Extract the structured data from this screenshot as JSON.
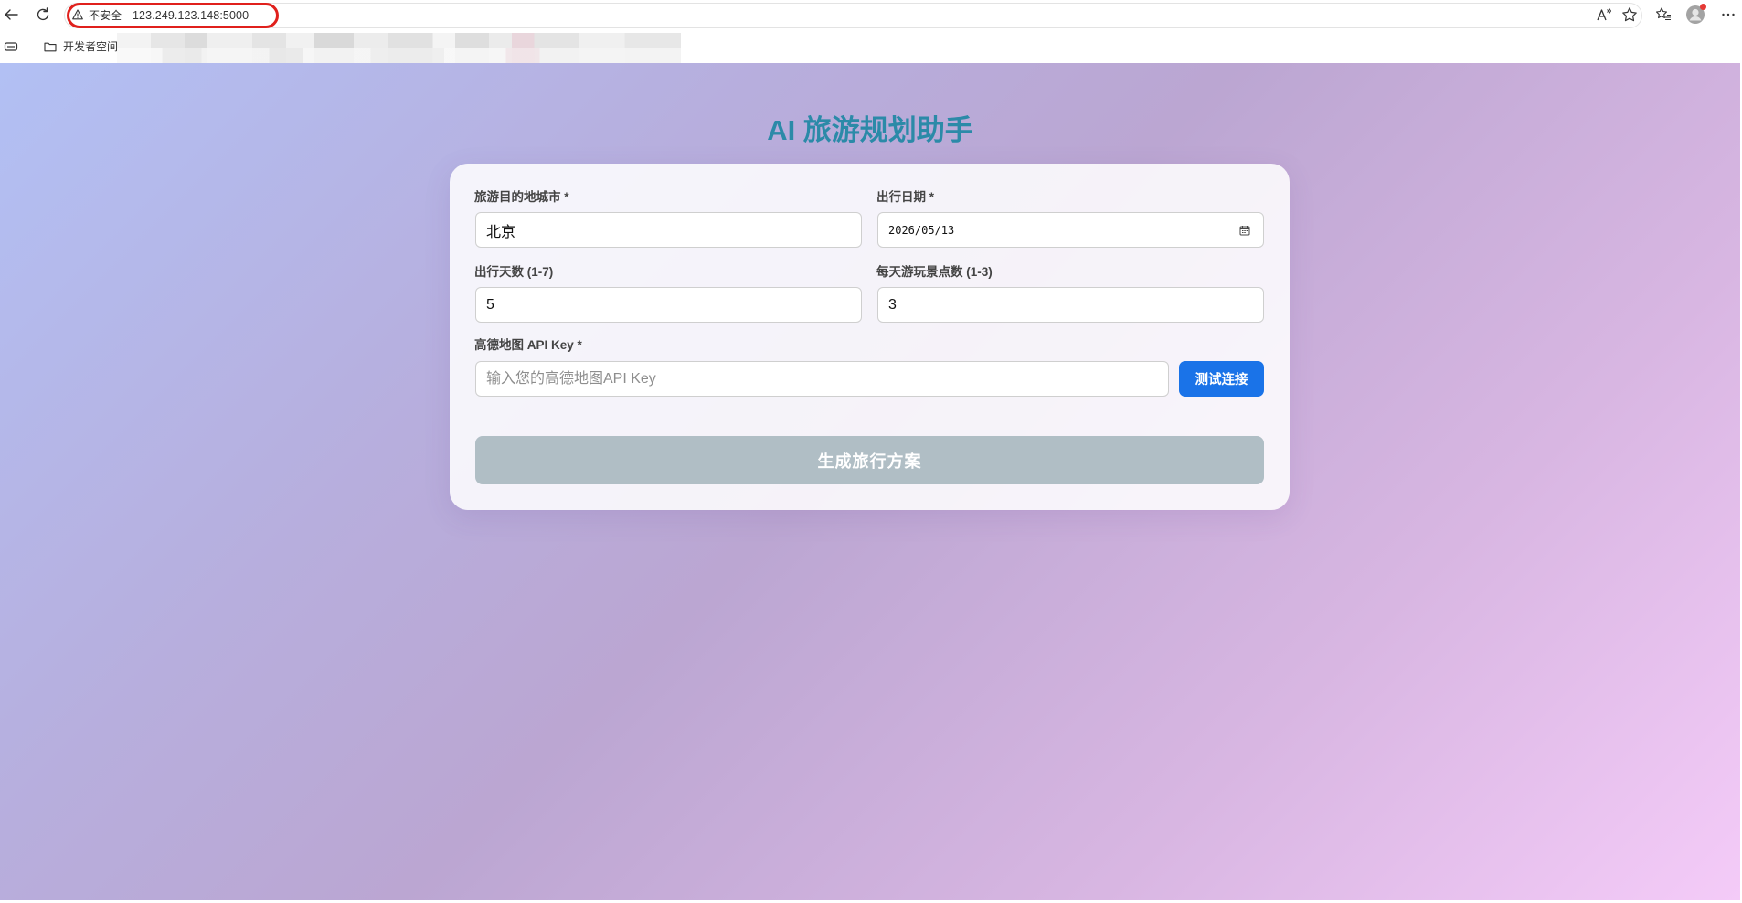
{
  "browser": {
    "security_label": "不安全",
    "url": "123.249.123.148:5000",
    "icons": [
      "back-arrow-icon",
      "refresh-icon",
      "warning-icon",
      "read-aloud-icon",
      "favorite-star-icon",
      "favorites-icon",
      "profile-icon",
      "more-icon"
    ]
  },
  "bookmarks_bar": {
    "folder_label": "开发者空间",
    "icons": [
      "apps-icon",
      "folder-icon"
    ]
  },
  "page": {
    "title": "AI 旅游规划助手",
    "form": {
      "destination": {
        "label": "旅游目的地城市 *",
        "value": "北京"
      },
      "date": {
        "label": "出行日期 *",
        "value": "2026/05/13"
      },
      "days": {
        "label": "出行天数 (1-7)",
        "value": "5"
      },
      "spots": {
        "label": "每天游玩景点数 (1-3)",
        "value": "3"
      },
      "api_key": {
        "label": "高德地图 API Key *",
        "placeholder": "输入您的高德地图API Key"
      },
      "test_button": "测试连接",
      "generate_button": "生成旅行方案"
    }
  },
  "colors": {
    "title": "#2b8aa8",
    "accent_button": "#1a73e8",
    "disabled_button": "#b0bec5",
    "annotation_outline": "#e0201c",
    "background_start": "#b2c0f4",
    "background_end": "#f4cbf8"
  }
}
